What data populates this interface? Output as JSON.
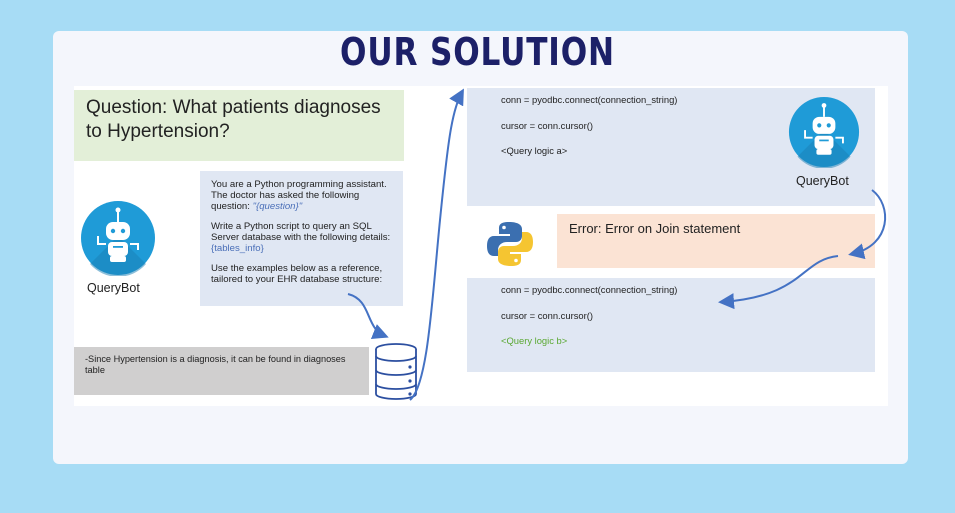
{
  "slide": {
    "title": "OUR SOLUTION",
    "question": "Question: What patients diagnoses to Hypertension?",
    "bot_name": "QueryBot",
    "prompt": {
      "p1_text": "You are a Python programming assistant. The doctor has asked the following question: ",
      "p1_var": "\"{question}\"",
      "p2_text": "Write a Python script to query an SQL Server database with the following details: ",
      "p2_var": "{tables_info}",
      "p3_text": "Use the examples below as a reference, tailored to your EHR database structure:"
    },
    "note": "-Since Hypertension is a diagnosis, it can be found in diagnoses table",
    "code_block_1": {
      "line1": "conn = pyodbc.connect(connection_string)",
      "line2": "cursor = conn.cursor()",
      "line3": "<Query logic a>"
    },
    "error": "Error: Error on Join statement",
    "code_block_2": {
      "line1": "conn = pyodbc.connect(connection_string)",
      "line2": "cursor = conn.cursor()",
      "line3": "<Query logic b>"
    }
  },
  "icons": [
    "robot-icon",
    "database-icon",
    "python-logo-icon",
    "arrow-icon"
  ],
  "colors": {
    "background": "#a7dcf5",
    "title": "#1c2068",
    "question_box": "#e3efd8",
    "prompt_box": "#e0e7f3",
    "note_box": "#d0cfcf",
    "error_box": "#fbe3d4",
    "arrow": "#4472c4",
    "bot_circle": "#1f9bd7"
  }
}
